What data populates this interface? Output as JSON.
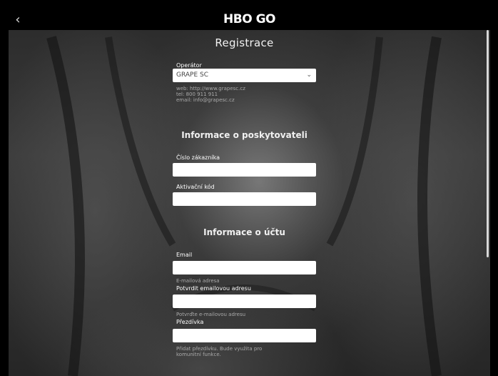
{
  "header": {
    "back_glyph": "‹",
    "logo_text": "HBO GO"
  },
  "page": {
    "title": "Registrace"
  },
  "operator": {
    "label": "Operátor",
    "selected": "GRAPE SC",
    "web": "web: http://www.grapesc.cz",
    "tel": "tel: 800 911 911",
    "email": "email: info@grapesc.cz"
  },
  "provider_section": {
    "title": "Informace o poskytovateli",
    "customer_number_label": "Číslo zákazníka",
    "activation_code_label": "Aktivační kód"
  },
  "account_section": {
    "title": "Informace o účtu",
    "email_label": "Email",
    "email_help": "E-mailová adresa",
    "confirm_email_label": "Potvrdit emailovou adresu",
    "confirm_email_help": "Potvrďte e-mailovou adresu",
    "nickname_label": "Přezdívka",
    "nickname_help_line1": "Přidat přezdívku. Bude využita pro",
    "nickname_help_line2": "komunitní funkce."
  },
  "icons": {
    "back": "chevron-left-icon",
    "dropdown": "chevron-down-icon"
  },
  "colors": {
    "topbar": "#000000",
    "field": "#ffffff",
    "muted_text": "#aaaaaa"
  }
}
